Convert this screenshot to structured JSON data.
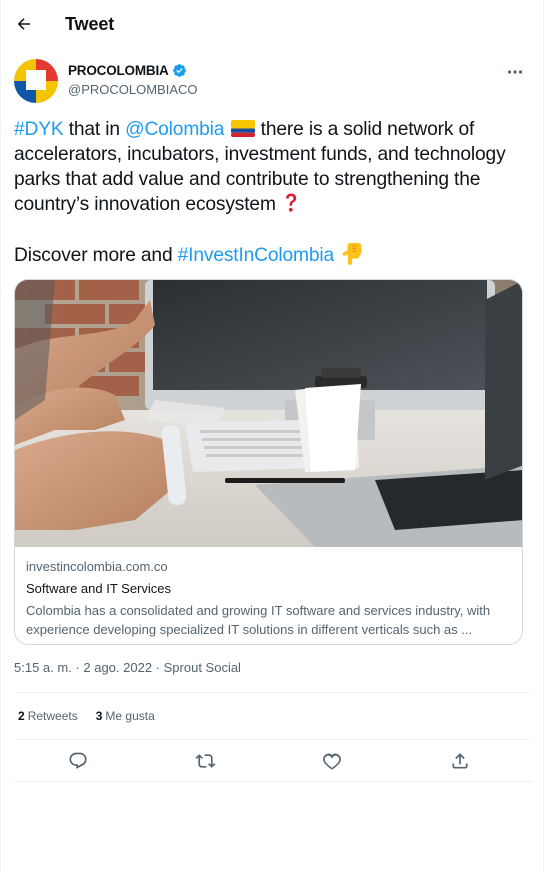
{
  "header": {
    "title": "Tweet"
  },
  "author": {
    "display_name": "PROCOLOMBIA",
    "handle": "@PROCOLOMBIACO"
  },
  "tweet": {
    "p1_tag1": "#DYK",
    "p1_t1": " that in ",
    "p1_mention": "@Colombia",
    "p1_t2": " there is a solid network of accelerators, incubators, investment funds, and technology parks that add value and contribute to strengthening the country’s innovation ecosystem",
    "p2_t1": "Discover more and ",
    "p2_tag": "#InvestInColombia",
    "emoji_flag": "colombia-flag",
    "emoji_question": "red-question-mark",
    "emoji_point": "backhand-index-pointing-down"
  },
  "card": {
    "domain": "investincolombia.com.co",
    "title": "Software and IT Services",
    "description": "Colombia has a consolidated and growing IT software and services industry, with experience developing specialized IT solutions in different verticals such as ..."
  },
  "meta": {
    "time": "5:15 a. m.",
    "sep": " · ",
    "date": "2 ago. 2022",
    "source": "Sprout Social"
  },
  "stats": {
    "retweets_count": "2",
    "retweets_label": "Retweets",
    "likes_count": "3",
    "likes_label": "Me gusta"
  },
  "icons": {
    "back": "back-arrow-icon",
    "verified": "verified-badge-icon",
    "more": "more-dots-icon",
    "reply": "reply-icon",
    "retweet": "retweet-icon",
    "like": "heart-icon",
    "share": "share-icon"
  },
  "colors": {
    "link": "#1d9bf0",
    "text": "#0f1419",
    "secondary": "#536471",
    "border": "#cfd9de",
    "divider": "#eff3f4"
  }
}
